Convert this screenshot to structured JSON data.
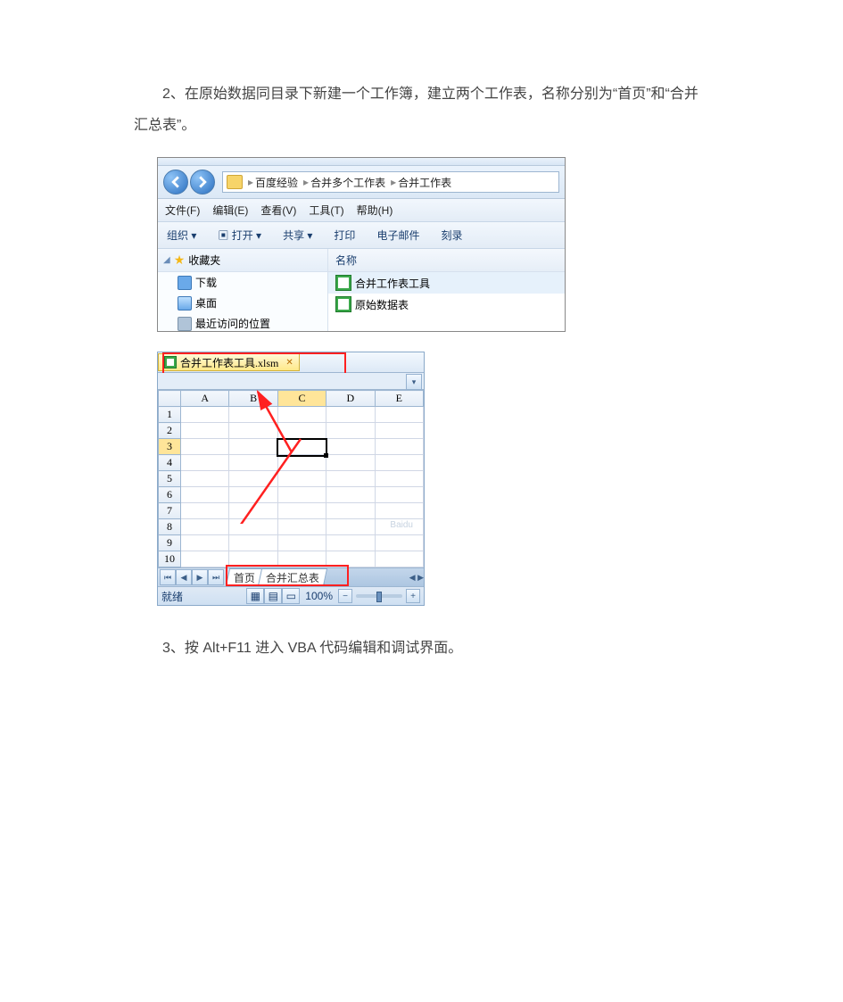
{
  "step2_text": "2、在原始数据同目录下新建一个工作簿，建立两个工作表，名称分别为“首页”和“合并汇总表”。",
  "step3_text": "3、按 Alt+F11 进入 VBA 代码编辑和调试界面。",
  "explorer": {
    "breadcrumb": [
      "百度经验",
      "合并多个工作表",
      "合并工作表"
    ],
    "menu": {
      "file": "文件(F)",
      "edit": "编辑(E)",
      "view": "查看(V)",
      "tools": "工具(T)",
      "help": "帮助(H)"
    },
    "toolbar": {
      "organize": "组织 ▾",
      "open": "▣ 打开 ▾",
      "share": "共享 ▾",
      "print": "打印",
      "email": "电子邮件",
      "burn": "刻录"
    },
    "sidebar": {
      "favorites": "收藏夹",
      "downloads": "下载",
      "desktop": "桌面",
      "recent": "最近访问的位置"
    },
    "column_name": "名称",
    "files": [
      "合并工作表工具",
      "原始数据表"
    ]
  },
  "excel": {
    "file_tab": "合并工作表工具.xlsm",
    "columns": [
      "A",
      "B",
      "C",
      "D",
      "E"
    ],
    "rows": [
      "1",
      "2",
      "3",
      "4",
      "5",
      "6",
      "7",
      "8",
      "9",
      "10"
    ],
    "sheet_tabs": {
      "sheet1": "首页",
      "sheet2": "合并汇总表"
    },
    "status": "就绪",
    "zoom": "100%",
    "watermark": "Baidu"
  }
}
